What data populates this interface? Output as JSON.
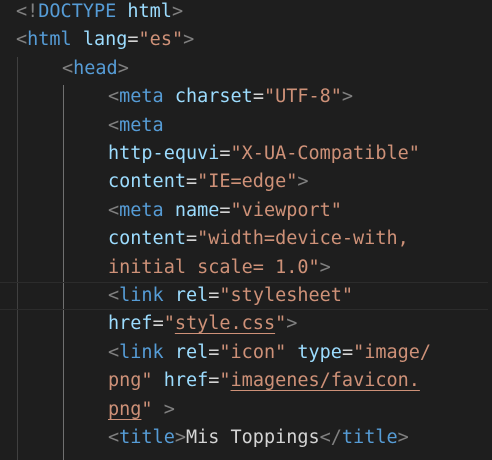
{
  "editor": {
    "language": "html",
    "colors": {
      "background": "#1e1e1e",
      "punctuation": "#808080",
      "tag": "#569cd6",
      "attribute": "#9cdcfe",
      "string": "#ce9178",
      "text": "#d4d4d4",
      "indent_guide": "#404040",
      "active_indent_guide": "#707070"
    },
    "lines": [
      {
        "tokens": [
          {
            "t": "<!",
            "c": "punc"
          },
          {
            "t": "DOCTYPE",
            "c": "tag"
          },
          {
            "t": " html",
            "c": "attr"
          },
          {
            "t": ">",
            "c": "punc"
          }
        ]
      },
      {
        "tokens": [
          {
            "t": "<",
            "c": "punc"
          },
          {
            "t": "html",
            "c": "tag"
          },
          {
            "t": " ",
            "c": "text"
          },
          {
            "t": "lang",
            "c": "attr"
          },
          {
            "t": "=",
            "c": "text"
          },
          {
            "t": "\"es\"",
            "c": "str"
          },
          {
            "t": ">",
            "c": "punc"
          }
        ]
      },
      {
        "tokens": [
          {
            "t": "<",
            "c": "punc"
          },
          {
            "t": "head",
            "c": "tag"
          },
          {
            "t": ">",
            "c": "punc"
          }
        ]
      },
      {
        "tokens": [
          {
            "t": "<",
            "c": "punc"
          },
          {
            "t": "meta",
            "c": "tag"
          },
          {
            "t": " ",
            "c": "text"
          },
          {
            "t": "charset",
            "c": "attr"
          },
          {
            "t": "=",
            "c": "text"
          },
          {
            "t": "\"UTF-8\"",
            "c": "str"
          },
          {
            "t": ">",
            "c": "punc"
          }
        ]
      },
      {
        "tokens": [
          {
            "t": "<",
            "c": "punc"
          },
          {
            "t": "meta",
            "c": "tag"
          }
        ]
      },
      {
        "tokens": [
          {
            "t": "http-equvi",
            "c": "attr"
          },
          {
            "t": "=",
            "c": "text"
          },
          {
            "t": "\"X-UA-Compatible\"",
            "c": "str"
          }
        ]
      },
      {
        "tokens": [
          {
            "t": "content",
            "c": "attr"
          },
          {
            "t": "=",
            "c": "text"
          },
          {
            "t": "\"IE=edge\"",
            "c": "str"
          },
          {
            "t": ">",
            "c": "punc"
          }
        ]
      },
      {
        "tokens": [
          {
            "t": "<",
            "c": "punc"
          },
          {
            "t": "meta",
            "c": "tag"
          },
          {
            "t": " ",
            "c": "text"
          },
          {
            "t": "name",
            "c": "attr"
          },
          {
            "t": "=",
            "c": "text"
          },
          {
            "t": "\"viewport\"",
            "c": "str"
          }
        ]
      },
      {
        "tokens": [
          {
            "t": "content",
            "c": "attr"
          },
          {
            "t": "=",
            "c": "text"
          },
          {
            "t": "\"width=device-with,",
            "c": "str"
          }
        ]
      },
      {
        "tokens": [
          {
            "t": "initial scale= 1.0\"",
            "c": "str"
          },
          {
            "t": ">",
            "c": "punc"
          }
        ]
      },
      {
        "current": true,
        "tokens": [
          {
            "t": "<",
            "c": "punc"
          },
          {
            "t": "link",
            "c": "tag"
          },
          {
            "t": " ",
            "c": "text"
          },
          {
            "t": "rel",
            "c": "attr"
          },
          {
            "t": "=",
            "c": "text"
          },
          {
            "t": "\"stylesheet\"",
            "c": "str"
          }
        ]
      },
      {
        "tokens": [
          {
            "t": "href",
            "c": "attr"
          },
          {
            "t": "=",
            "c": "text"
          },
          {
            "t": "\"",
            "c": "str"
          },
          {
            "t": "style.css",
            "c": "link"
          },
          {
            "t": "\"",
            "c": "str"
          },
          {
            "t": ">",
            "c": "punc"
          }
        ]
      },
      {
        "tokens": [
          {
            "t": "<",
            "c": "punc"
          },
          {
            "t": "link",
            "c": "tag"
          },
          {
            "t": " ",
            "c": "text"
          },
          {
            "t": "rel",
            "c": "attr"
          },
          {
            "t": "=",
            "c": "text"
          },
          {
            "t": "\"icon\"",
            "c": "str"
          },
          {
            "t": " ",
            "c": "text"
          },
          {
            "t": "type",
            "c": "attr"
          },
          {
            "t": "=",
            "c": "text"
          },
          {
            "t": "\"image/",
            "c": "str"
          }
        ]
      },
      {
        "tokens": [
          {
            "t": "png\"",
            "c": "str"
          },
          {
            "t": " ",
            "c": "text"
          },
          {
            "t": "href",
            "c": "attr"
          },
          {
            "t": "=",
            "c": "text"
          },
          {
            "t": "\"",
            "c": "str"
          },
          {
            "t": "imagenes/favicon.",
            "c": "link"
          }
        ]
      },
      {
        "tokens": [
          {
            "t": "png",
            "c": "link"
          },
          {
            "t": "\"",
            "c": "str"
          },
          {
            "t": " >",
            "c": "punc"
          }
        ]
      },
      {
        "tokens": [
          {
            "t": "<",
            "c": "punc"
          },
          {
            "t": "title",
            "c": "tag"
          },
          {
            "t": ">",
            "c": "punc"
          },
          {
            "t": "Mis Toppings",
            "c": "text"
          },
          {
            "t": "</",
            "c": "punc"
          },
          {
            "t": "title",
            "c": "tag"
          },
          {
            "t": ">",
            "c": "punc"
          }
        ]
      }
    ]
  }
}
